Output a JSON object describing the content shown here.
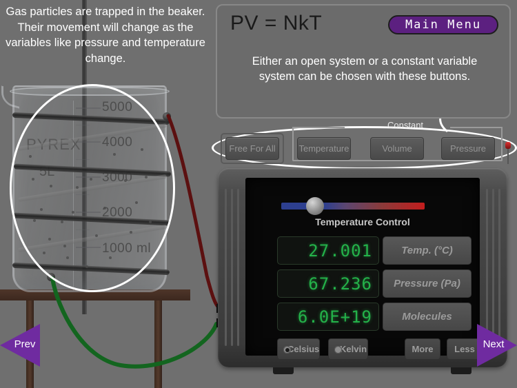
{
  "caption_left": "Gas particles are trapped in the beaker. Their movement will change as the variables like pressure and temperature change.",
  "info_panel": {
    "equation": "PV = NkT",
    "main_menu_label": "Main Menu",
    "body_text": "Either an open system or a constant variable system can be chosen with these buttons."
  },
  "constant_group": {
    "group_label": "Constant",
    "buttons": [
      {
        "label": "Free For All",
        "selected": true
      },
      {
        "label": "Temperature",
        "selected": false
      },
      {
        "label": "Volume",
        "selected": false
      },
      {
        "label": "Pressure",
        "selected": false
      }
    ]
  },
  "device": {
    "slider_label": "Temperature Control",
    "slider_position_percent": 28,
    "readouts": [
      {
        "value": "27.001",
        "label": "Temp. (°C)"
      },
      {
        "value": "67.236",
        "label": "Pressure (Pa)"
      },
      {
        "value": "6.0E+19",
        "label": "Molecules"
      }
    ],
    "unit_options": [
      {
        "label": "Celsius",
        "selected": true
      },
      {
        "label": "Kelvin",
        "selected": false
      }
    ],
    "step_buttons": [
      {
        "label": "More"
      },
      {
        "label": "Less"
      }
    ]
  },
  "beaker": {
    "brand": "PYREX",
    "capacity": "5L",
    "graduations": [
      "5000",
      "4000",
      "3000",
      "2000",
      "1000 ml"
    ]
  },
  "navigation": {
    "prev_label": "Prev",
    "next_label": "Next"
  },
  "colors": {
    "accent_purple": "#6f2ba0",
    "menu_purple": "#5c2080",
    "lcd_green": "#24b24a",
    "annotation_white": "#ffffff",
    "background_gray": "#6f6f6f"
  }
}
